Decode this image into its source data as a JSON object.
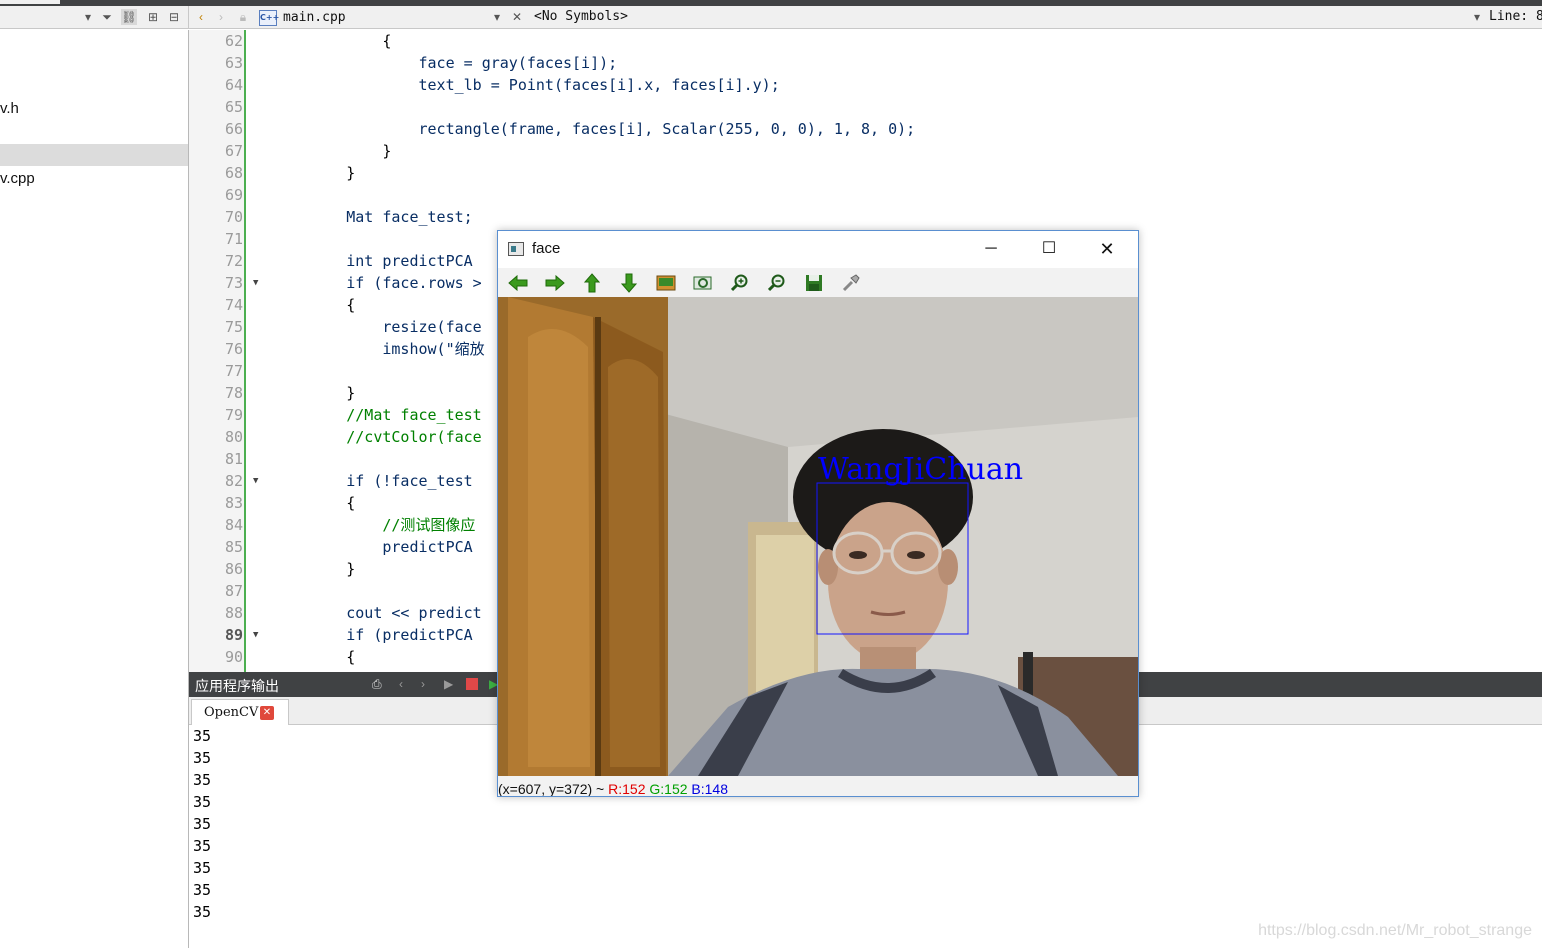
{
  "toolbar": {
    "file_name": "main.cpp",
    "symbols": "<No Symbols>",
    "line_label": "Line: 8"
  },
  "project_tree": {
    "items": [
      "v.h",
      "",
      "v.cpp"
    ]
  },
  "editor": {
    "lines": [
      {
        "n": "62",
        "text": "            {"
      },
      {
        "n": "63",
        "text": "                face = gray(faces[i]);"
      },
      {
        "n": "64",
        "text": "                text_lb = Point(faces[i].x, faces[i].y);"
      },
      {
        "n": "65",
        "text": ""
      },
      {
        "n": "66",
        "text": "                rectangle(frame, faces[i], Scalar(255, 0, 0), 1, 8, 0);"
      },
      {
        "n": "67",
        "text": "            }"
      },
      {
        "n": "68",
        "text": "        }"
      },
      {
        "n": "69",
        "text": ""
      },
      {
        "n": "70",
        "text": "        Mat face_test;"
      },
      {
        "n": "71",
        "text": ""
      },
      {
        "n": "72",
        "text": "        int predictPCA"
      },
      {
        "n": "73",
        "text": "        if (face.rows >"
      },
      {
        "n": "74",
        "text": "        {"
      },
      {
        "n": "75",
        "text": "            resize(face"
      },
      {
        "n": "76",
        "text": "            imshow(\"缩放"
      },
      {
        "n": "77",
        "text": ""
      },
      {
        "n": "78",
        "text": "        }"
      },
      {
        "n": "79",
        "text": "        //Mat face_test"
      },
      {
        "n": "80",
        "text": "        //cvtColor(face"
      },
      {
        "n": "81",
        "text": ""
      },
      {
        "n": "82",
        "text": "        if (!face_test"
      },
      {
        "n": "83",
        "text": "        {"
      },
      {
        "n": "84",
        "text": "            //测试图像应"
      },
      {
        "n": "85",
        "text": "            predictPCA"
      },
      {
        "n": "86",
        "text": "        }"
      },
      {
        "n": "87",
        "text": ""
      },
      {
        "n": "88",
        "text": "        cout << predict"
      },
      {
        "n": "89",
        "text": "        if (predictPCA"
      },
      {
        "n": "90",
        "text": "        {"
      }
    ]
  },
  "output": {
    "title": "应用程序输出",
    "tab_label": "OpenCV",
    "lines": [
      "35",
      "35",
      "35",
      "35",
      "35",
      "35",
      "35",
      "35",
      "35"
    ]
  },
  "watermark": "https://blog.csdn.net/Mr_robot_strange",
  "face_window": {
    "title": "face",
    "label_text": "WangJiChuan",
    "status": {
      "coords": "(x=607, y=372) ~ ",
      "r": "R:152",
      "g": "G:152",
      "b": "B:148"
    }
  },
  "colors": {
    "editor_gutter_bar": "#4caf50",
    "dark_header": "#404244",
    "detection_box": "#0000ff"
  }
}
